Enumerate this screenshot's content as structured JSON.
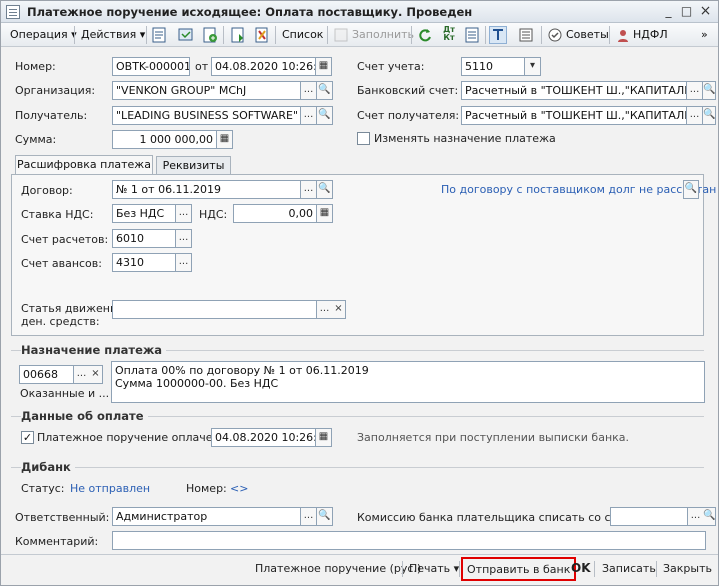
{
  "window": {
    "title": "Платежное поручение исходящее: Оплата поставщику. Проведен",
    "controls": {
      "minimize": "_",
      "maximize": "□",
      "close": "×"
    }
  },
  "toolbar": {
    "operation": "Операция",
    "actions": "Действия",
    "list": "Список",
    "fill": "Заполнить",
    "tips": "Советы",
    "ndfl": "НДФЛ",
    "dt_kt": "Дт Кт",
    "dropdown_arrow": "▾",
    "more": "»"
  },
  "header": {
    "number_label": "Номер:",
    "number_value": "OBTK-000001",
    "from_label": "от",
    "date_value": "04.08.2020 10:26:53",
    "org_label": "Организация:",
    "org_value": "\"VENKON GROUP\" MChJ",
    "recipient_label": "Получатель:",
    "recipient_value": "\"LEADING BUSINESS SOFTWARE\" MChJ",
    "sum_label": "Сумма:",
    "sum_value": "1 000 000,00",
    "account_label": "Счет учета:",
    "account_value": "5110",
    "bank_account_label": "Банковский счет:",
    "bank_account_value": "Расчетный в \"ТОШКЕНТ Ш.,\"КАПИТАЛБАНК\"",
    "recipient_account_label": "Счет получателя:",
    "recipient_account_value": "Расчетный в \"ТОШКЕНТ Ш.,\"КАПИТАЛБАНК\"",
    "change_purpose_label": "Изменять назначение платежа"
  },
  "tabs": [
    {
      "label": "Расшифровка платежа"
    },
    {
      "label": "Реквизиты"
    }
  ],
  "details": {
    "contract_label": "Договор:",
    "contract_value": "№ 1 от 06.11.2019",
    "contract_debt_link": "По договору с поставщиком долг не рассчитан",
    "vat_rate_label": "Ставка НДС:",
    "vat_rate_value": "Без НДС",
    "vat_label": "НДС:",
    "vat_value": "0,00",
    "settlement_account_label": "Счет расчетов:",
    "settlement_account_value": "6010",
    "advance_account_label": "Счет авансов:",
    "advance_account_value": "4310",
    "cash_flow_label_1": "Статья движения",
    "cash_flow_label_2": "ден. средств:",
    "cash_flow_value": ""
  },
  "purpose": {
    "group_title": "Назначение платежа",
    "code_value": "00668",
    "code_caption": "Оказанные и ...",
    "text": "Оплата 00% по договору № 1 от 06.11.2019\nСумма 1000000-00. Без НДС"
  },
  "payment": {
    "group_title": "Данные об оплате",
    "paid_label": "Платежное поручение оплачено:",
    "paid_checked": true,
    "paid_date": "04.08.2020 10:26:53",
    "hint": "Заполняется при поступлении выписки банка."
  },
  "dibank": {
    "group_title": "Дибанк",
    "status_label": "Статус:",
    "status_value": "Не отправлен",
    "number_label": "Номер:",
    "number_value": "<>"
  },
  "footer_fields": {
    "responsible_label": "Ответственный:",
    "responsible_value": "Администратор",
    "commission_label": "Комиссию банка плательщика списать со счета:",
    "commission_value": "",
    "comment_label": "Комментарий:",
    "comment_value": ""
  },
  "bottom_bar": {
    "print_form": "Платежное поручение (рус.)",
    "print": "Печать",
    "send_to_bank": "Отправить в банк",
    "ok": "OK",
    "save": "Записать",
    "close": "Закрыть"
  },
  "colors": {
    "highlight_border": "#e00000",
    "link": "#2b5fb4"
  }
}
